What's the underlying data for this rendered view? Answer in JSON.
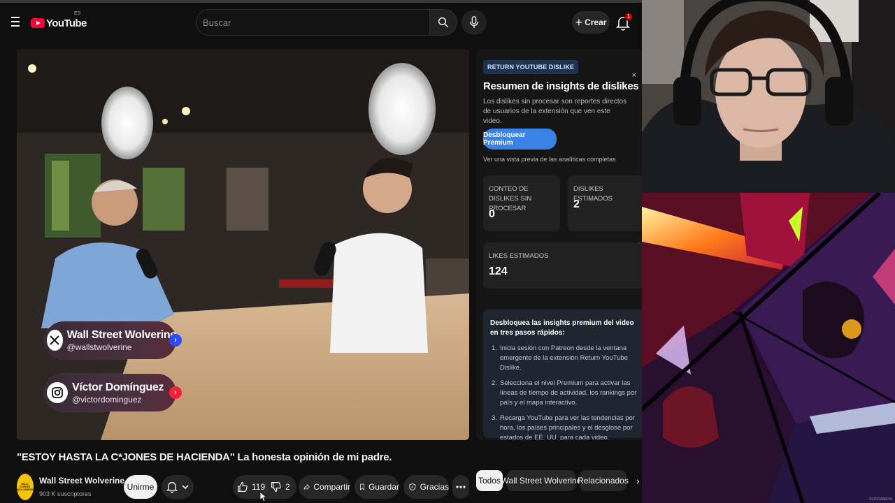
{
  "youtube": {
    "logo_text": "YouTube",
    "country_code": "ES",
    "search_placeholder": "Buscar",
    "create_label": "Crear",
    "notification_count": "1"
  },
  "video": {
    "title": "\"ESTOY HASTA LA C*JONES DE HACIENDA\" La honesta opinión de mi padre.",
    "overlays": [
      {
        "name": "Wall Street Wolverine",
        "handle": "@wallstwolverine",
        "network": "x-icon",
        "accent": "#2b4bff"
      },
      {
        "name": "Víctor Domínguez",
        "handle": "@victordominguez",
        "network": "instagram-icon",
        "accent": "#ff1f3d"
      }
    ]
  },
  "channel": {
    "avatar_text": "WALL STREET WOLVERINE",
    "name": "Wall Street Wolverine",
    "subscribers": "903 K suscriptores",
    "join_label": "Unirme"
  },
  "actions": {
    "likes": "119",
    "dislikes": "2",
    "share_label": "Compartir",
    "save_label": "Guardar",
    "thanks_label": "Gracias"
  },
  "ryd": {
    "badge": "RETURN YOUTUBE DISLIKE",
    "close": "×",
    "title": "Resumen de insights de dislikes",
    "description": "Los dislikes sin procesar son reportes directos de usuarios de la extensión que ven este video.",
    "premium_button": "Desbloquear Premium",
    "preview_text": "Ver una vista previa de las analíticas completas",
    "raw_dislikes_label": "CONTEO DE DISLIKES SIN PROCESAR",
    "raw_dislikes_value": "0",
    "estimated_dislikes_label": "DISLIKES ESTIMADOS",
    "estimated_dislikes_value": "2",
    "estimated_likes_label": "LIKES ESTIMADOS",
    "estimated_likes_value": "124",
    "steps_title": "Desbloquea las insights premium del video en tres pasos rápidos:",
    "steps": [
      {
        "n": "1.",
        "text": "Inicia sesión con Patreon desde la ventana emergente de la extensión Return YouTube Dislike."
      },
      {
        "n": "2.",
        "text": "Selecciona el nivel Premium para activar las líneas de tiempo de actividad, los rankings por país y el mapa interactivo."
      },
      {
        "n": "3.",
        "text": "Recarga YouTube para ver las tendencias por hora, los países principales y el desglose por estados de EE. UU. para cada video."
      }
    ],
    "accent": "#3b82e6"
  },
  "chips": {
    "all": "Todos",
    "channel": "Wall Street Wolverine",
    "related": "Relacionados"
  },
  "watermark": "JOJOGAMEYA"
}
